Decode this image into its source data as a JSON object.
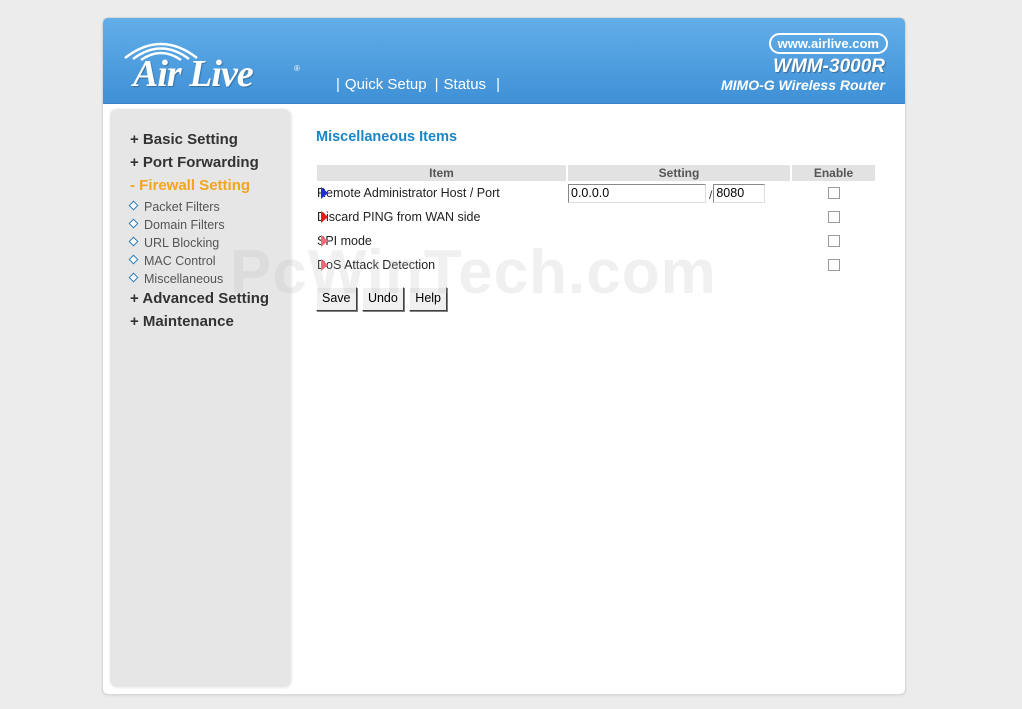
{
  "brand": {
    "logo_text": "Air Live",
    "registered": "®",
    "url": "www.airlive.com",
    "model": "WMM-3000R",
    "subtitle": "MIMO-G Wireless Router"
  },
  "topnav": {
    "separator": "|",
    "quick_setup": "Quick Setup",
    "status": "Status"
  },
  "sidebar": {
    "basic_setting": "+ Basic Setting",
    "port_forwarding": "+ Port Forwarding",
    "firewall_setting": "- Firewall Setting",
    "firewall_items": [
      "Packet Filters",
      "Domain Filters",
      "URL Blocking",
      "MAC Control",
      "Miscellaneous"
    ],
    "advanced_setting": "+ Advanced Setting",
    "maintenance": "+ Maintenance",
    "active_color": "#f2a51e"
  },
  "main": {
    "title": "Miscellaneous Items",
    "columns": [
      "Item",
      "Setting",
      "Enable"
    ],
    "rows": [
      {
        "label": "Remote Administrator Host / Port",
        "host": "0.0.0.0",
        "slash": "/",
        "port": "8080",
        "enabled": false
      },
      {
        "label": "Discard PING from WAN side",
        "enabled": false
      },
      {
        "label": "SPI mode",
        "enabled": false
      },
      {
        "label": "DoS Attack Detection",
        "enabled": false
      }
    ],
    "buttons": {
      "save": "Save",
      "undo": "Undo",
      "help": "Help"
    }
  },
  "watermark": "PcWinTech.com",
  "colors": {
    "header_top": "#62aee9",
    "header_bottom": "#3f90d6",
    "title": "#1a86c6",
    "arrow_blue": "#1c2fd1",
    "arrow_red": "#e41c1c"
  }
}
